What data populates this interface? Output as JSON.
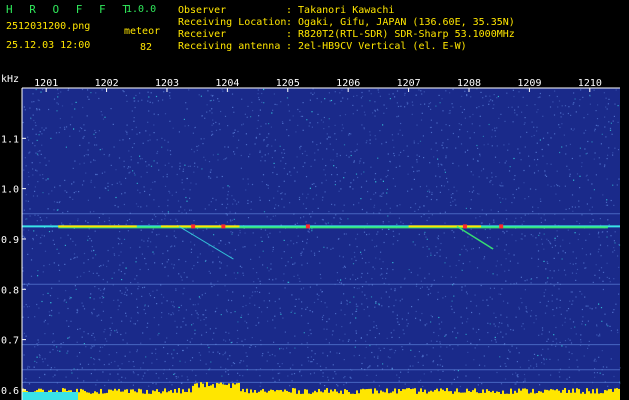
{
  "app": {
    "name": "H R O F F T",
    "version": "1.0.0"
  },
  "file": {
    "filename": "2512031200.png",
    "datetime": "25.12.03 12:00"
  },
  "meteor": {
    "label": "meteor",
    "count": "82"
  },
  "info": {
    "rows": [
      {
        "label": "Observer",
        "value": ": Takanori Kawachi"
      },
      {
        "label": "Receiving Location",
        "value": ": Ogaki, Gifu, JAPAN (136.60E, 35.35N)"
      },
      {
        "label": "Receiver",
        "value": ": R820T2(RTL-SDR) SDR-Sharp 53.1000MHz"
      },
      {
        "label": "Receiving antenna",
        "value": ": 2el-HB9CV Vertical (el. E-W)"
      }
    ]
  },
  "plot": {
    "y_unit": "kHz",
    "x_ticks": [
      "1201",
      "1202",
      "1203",
      "1204",
      "1205",
      "1206",
      "1207",
      "1208",
      "1209",
      "1210"
    ],
    "y_ticks": [
      "1.1",
      "1.0",
      "0.9",
      "0.8",
      "0.7",
      "0.6"
    ],
    "y_values": [
      1.1,
      1.0,
      0.9,
      0.8,
      0.7,
      0.6
    ],
    "y_range": [
      0.58,
      1.2
    ],
    "x_range": [
      1200.6,
      1210.5
    ],
    "carrier_khz": 0.925,
    "colors": {
      "background": "#1a2a8a",
      "noise_light": "#5a7fd8",
      "noise_cyan": "#39e3e8",
      "signal_yellow": "#ffe600",
      "signal_red": "#ff2a2a",
      "signal_green": "#38f070",
      "axis": "#ffffff"
    }
  }
}
